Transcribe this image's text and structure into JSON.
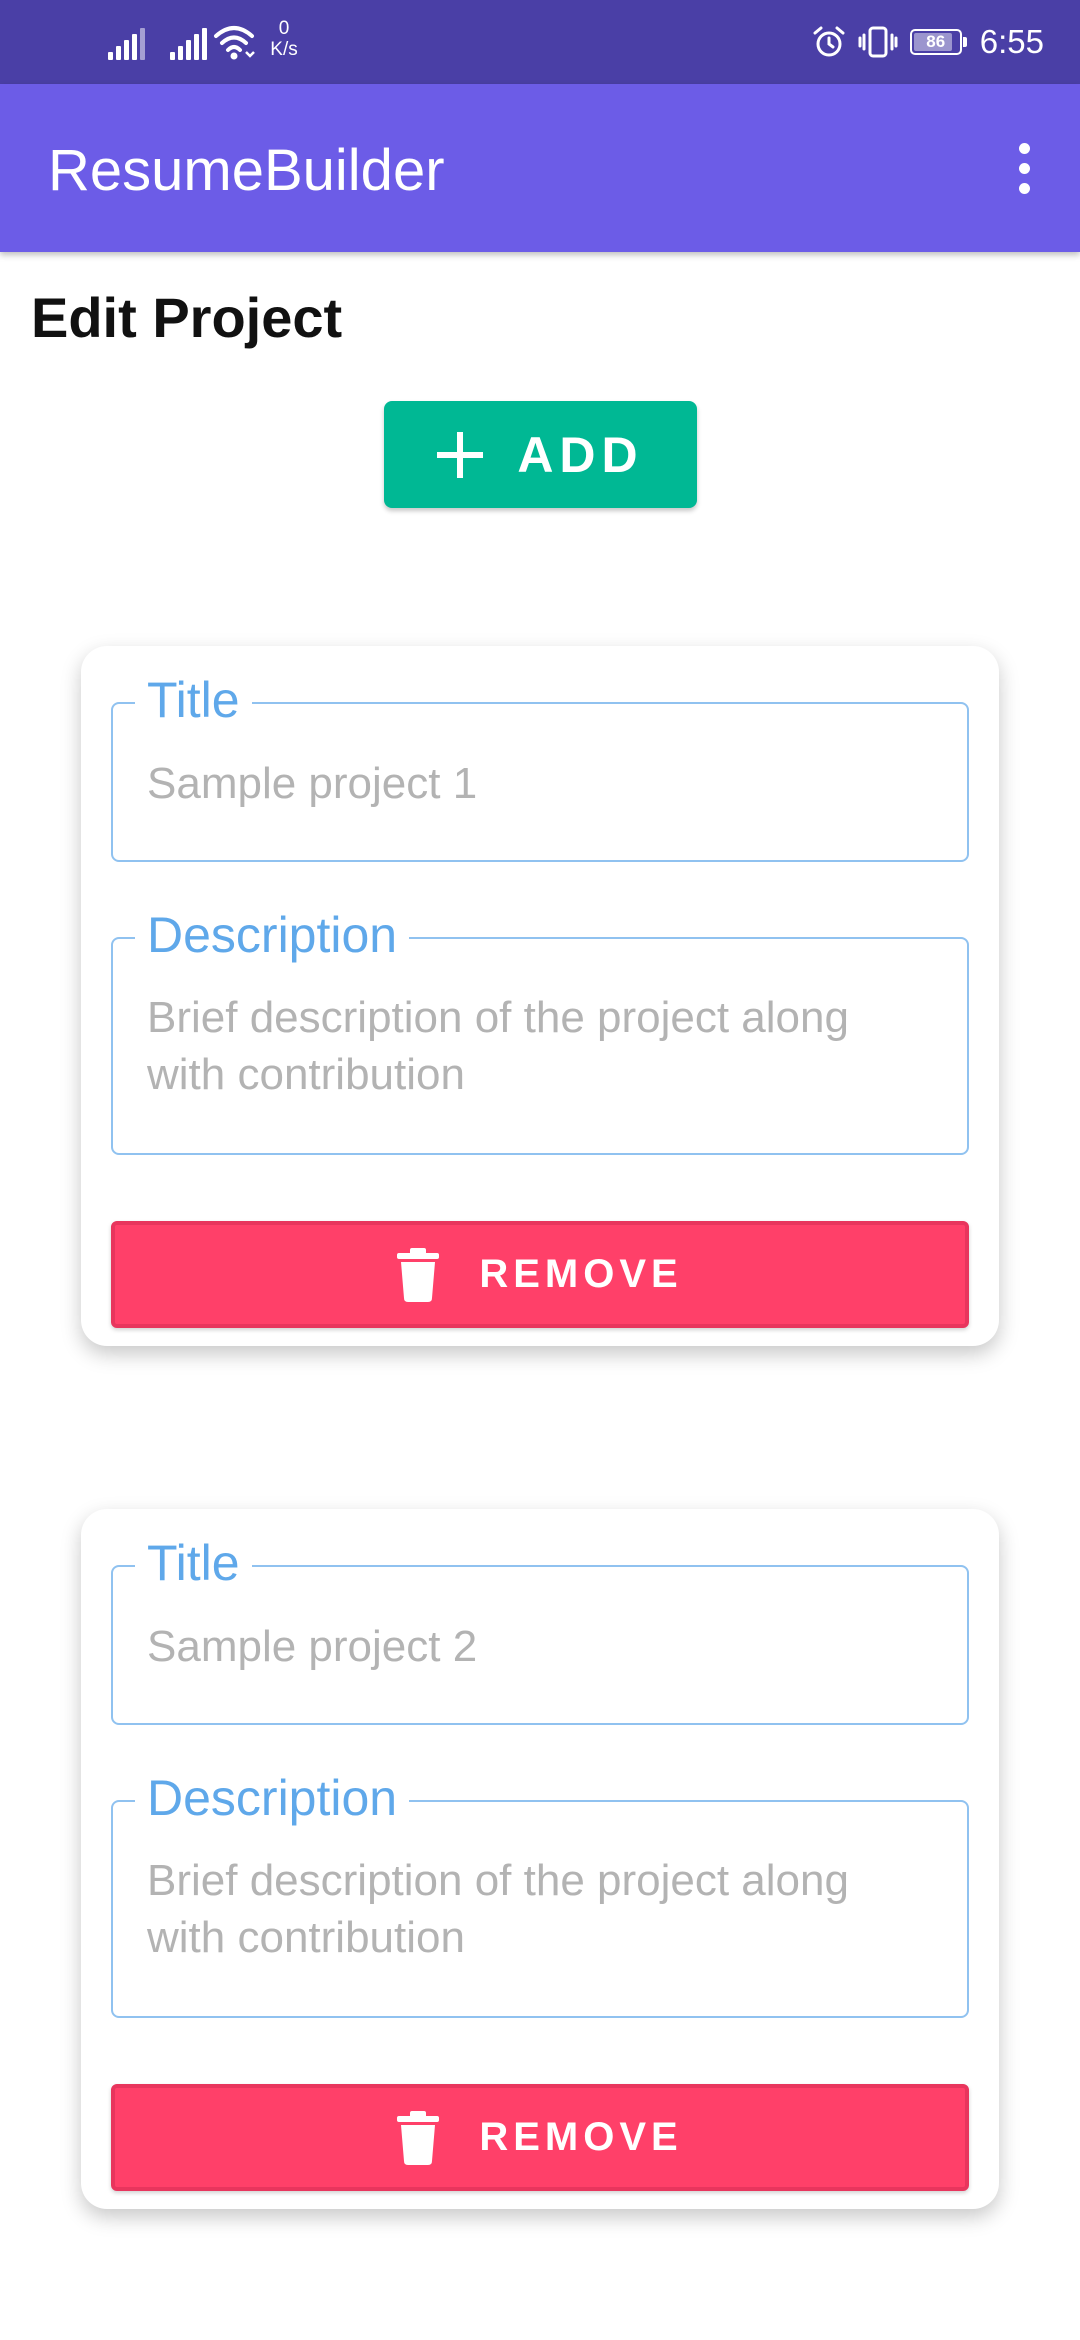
{
  "status_bar": {
    "net_speed_value": "0",
    "net_speed_unit": "K/s",
    "battery": "86",
    "battery_level": 0.86,
    "time": "6:55",
    "icons": [
      "signal-icon",
      "signal-icon",
      "wifi-icon",
      "alarm-icon",
      "vibrate-icon",
      "battery-icon"
    ]
  },
  "app_bar": {
    "title": "ResumeBuilder",
    "menu_icon": "more-vert-icon"
  },
  "page": {
    "title": "Edit Project",
    "add_label": "ADD",
    "add_icon": "plus-icon"
  },
  "projects": [
    {
      "title_label": "Title",
      "title_value": "Sample project 1",
      "description_label": "Description",
      "description_value": "Brief description of the project along with contribution",
      "remove_label": "REMOVE"
    },
    {
      "title_label": "Title",
      "title_value": "Sample project 2",
      "description_label": "Description",
      "description_value": "Brief description of the project along with contribution",
      "remove_label": "REMOVE"
    }
  ],
  "colors": {
    "status_bar": "#4a3fa6",
    "app_bar": "#6c5ce7",
    "add_button": "#00b894",
    "remove_button": "#ff4069",
    "field_accent": "#5fa8ea"
  }
}
